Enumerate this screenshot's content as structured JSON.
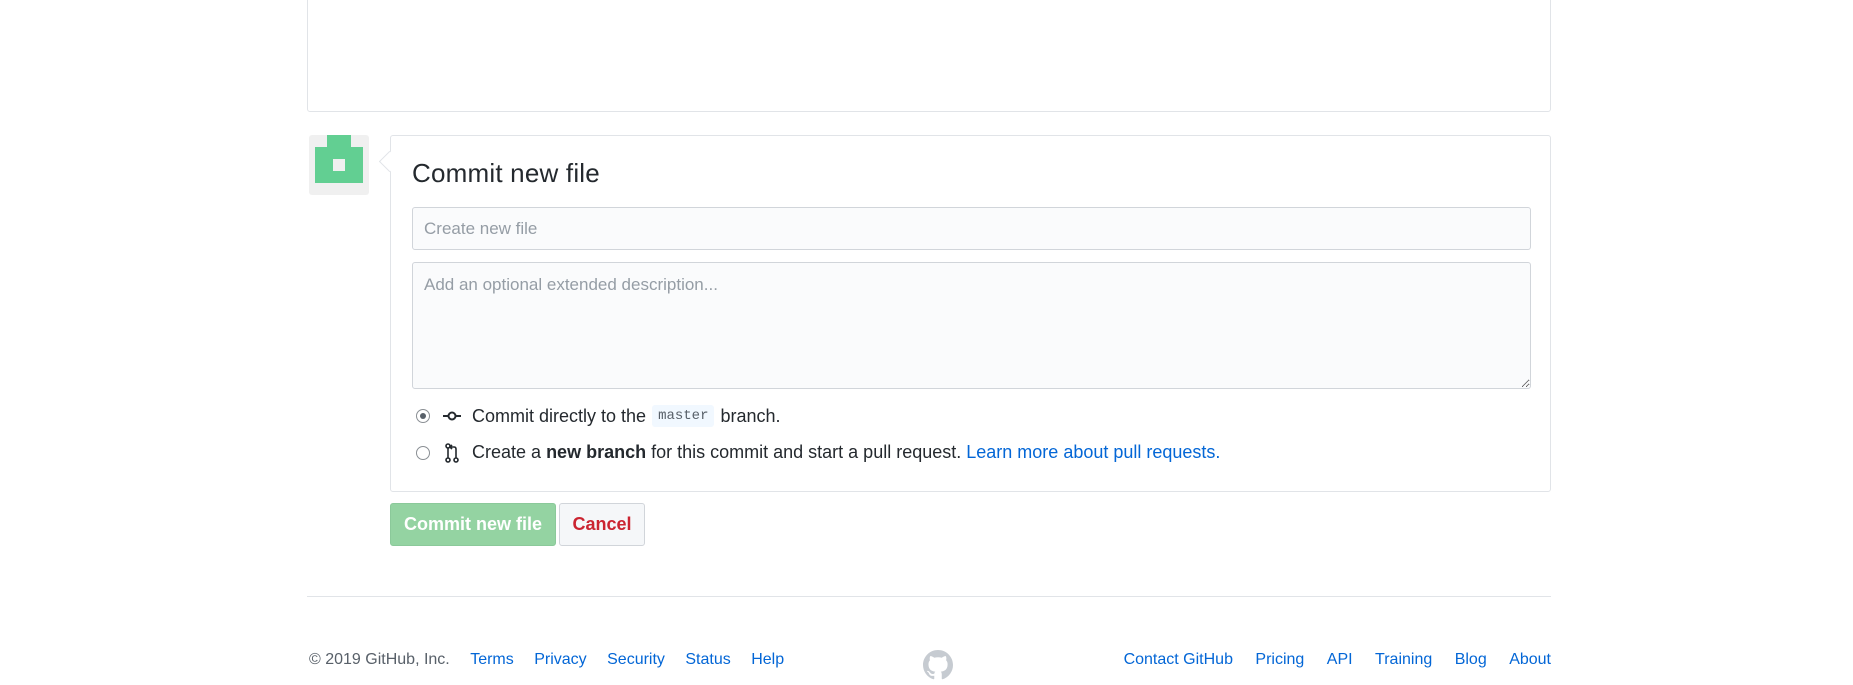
{
  "commit": {
    "title": "Commit new file",
    "summary_placeholder": "Create new file",
    "summary_value": "",
    "description_placeholder": "Add an optional extended description...",
    "description_value": "",
    "option_direct": {
      "prefix": "Commit directly to the",
      "branch": "master",
      "suffix": "branch.",
      "selected": true
    },
    "option_new_branch": {
      "prefix": "Create a",
      "bold": "new branch",
      "middle": "for this commit and start a pull request.",
      "link": "Learn more about pull requests.",
      "selected": false
    },
    "commit_button": "Commit new file",
    "cancel_button": "Cancel"
  },
  "footer": {
    "copyright": "© 2019 GitHub, Inc.",
    "left_links": [
      "Terms",
      "Privacy",
      "Security",
      "Status",
      "Help"
    ],
    "right_links": [
      "Contact GitHub",
      "Pricing",
      "API",
      "Training",
      "Blog",
      "About"
    ]
  },
  "icons": {
    "avatar": "identicon-avatar",
    "commit_option": "git-commit-icon",
    "branch_option": "git-pull-request-icon",
    "footer_logo": "github-mark-icon"
  },
  "colors": {
    "link": "#0366d6",
    "commit_button_bg": "#94d3a2",
    "cancel_text": "#cb2431",
    "identicon": "#62cf92"
  }
}
